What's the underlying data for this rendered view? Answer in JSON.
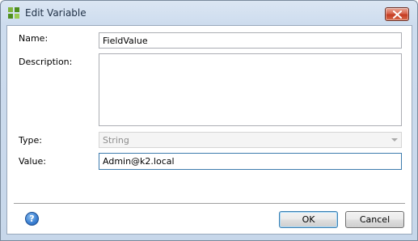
{
  "window": {
    "title": "Edit Variable",
    "icon": "k2-app-icon",
    "close_icon": "close-icon"
  },
  "form": {
    "name_label": "Name:",
    "name_value": "FieldValue",
    "description_label": "Description:",
    "description_value": "",
    "type_label": "Type:",
    "type_value": "String",
    "value_label": "Value:",
    "value_value": "Admin@k2.local"
  },
  "footer": {
    "help_icon": "help-icon",
    "help_glyph": "?",
    "ok_label": "OK",
    "cancel_label": "Cancel"
  },
  "colors": {
    "titlebar": "#cddcee",
    "close_button": "#c43c22",
    "help_icon": "#3f83d4",
    "focus_border": "#3d7bad"
  }
}
